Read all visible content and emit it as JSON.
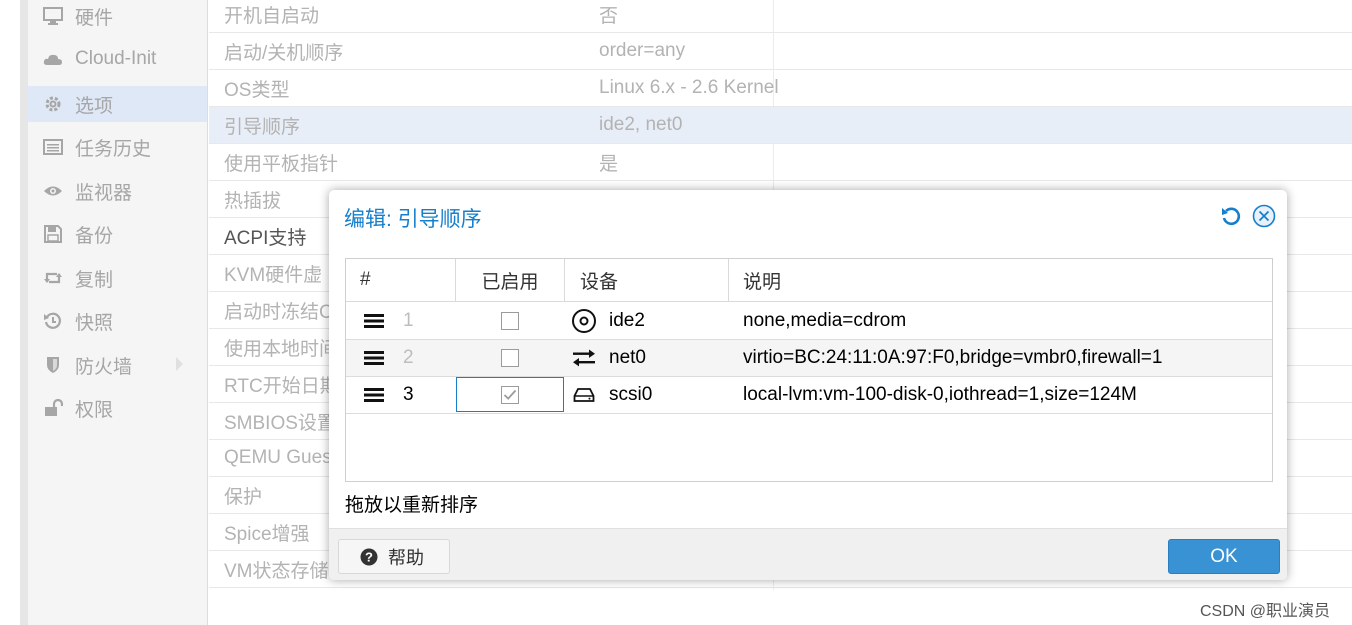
{
  "sidebar": {
    "items": [
      {
        "label": "硬件",
        "icon": "monitor-icon"
      },
      {
        "label": "Cloud-Init",
        "icon": "cloud-icon"
      },
      {
        "label": "选项",
        "icon": "gear-icon",
        "active": true
      },
      {
        "label": "任务历史",
        "icon": "list-icon"
      },
      {
        "label": "监视器",
        "icon": "eye-icon"
      },
      {
        "label": "备份",
        "icon": "floppy-icon"
      },
      {
        "label": "复制",
        "icon": "retweet-icon"
      },
      {
        "label": "快照",
        "icon": "history-icon"
      },
      {
        "label": "防火墙",
        "icon": "shield-icon",
        "has_submenu": true
      },
      {
        "label": "权限",
        "icon": "unlock-icon"
      }
    ]
  },
  "options_grid": {
    "rows": [
      {
        "key": "开机自启动",
        "value": "否"
      },
      {
        "key": "启动/关机顺序",
        "value": "order=any"
      },
      {
        "key": "OS类型",
        "value": "Linux 6.x - 2.6 Kernel"
      },
      {
        "key": "引导顺序",
        "value": "ide2, net0",
        "selected": true
      },
      {
        "key": "使用平板指针",
        "value": "是"
      },
      {
        "key": "热插拔",
        "value": ""
      },
      {
        "key": "ACPI支持",
        "value": ""
      },
      {
        "key": "KVM硬件虚",
        "value": ""
      },
      {
        "key": "启动时冻结C",
        "value": ""
      },
      {
        "key": "使用本地时间",
        "value": ""
      },
      {
        "key": "RTC开始日期",
        "value": ""
      },
      {
        "key": "SMBIOS设置",
        "value": ""
      },
      {
        "key": "QEMU Gues",
        "value": ""
      },
      {
        "key": "保护",
        "value": ""
      },
      {
        "key": "Spice增强",
        "value": ""
      },
      {
        "key": "VM状态存储",
        "value": ""
      }
    ]
  },
  "dialog": {
    "title": "编辑: 引导顺序",
    "columns": {
      "num": "#",
      "enabled": "已启用",
      "device": "设备",
      "desc": "说明"
    },
    "rows": [
      {
        "num": "1",
        "enabled": false,
        "icon": "disc-icon",
        "device": "ide2",
        "desc": "none,media=cdrom"
      },
      {
        "num": "2",
        "enabled": false,
        "icon": "exchange-icon",
        "device": "net0",
        "desc": "virtio=BC:24:11:0A:97:F0,bridge=vmbr0,firewall=1"
      },
      {
        "num": "3",
        "enabled": true,
        "icon": "hdd-icon",
        "device": "scsi0",
        "desc": "local-lvm:vm-100-disk-0,iothread=1,size=124M"
      }
    ],
    "hint": "拖放以重新排序",
    "help_label": "帮助",
    "ok_label": "OK"
  },
  "watermark": "CSDN @职业演员",
  "colors": {
    "accent": "#157fcc",
    "ok_button": "#3892d4",
    "selected_row": "#e8eef7",
    "active_nav": "#dfe8f6"
  }
}
